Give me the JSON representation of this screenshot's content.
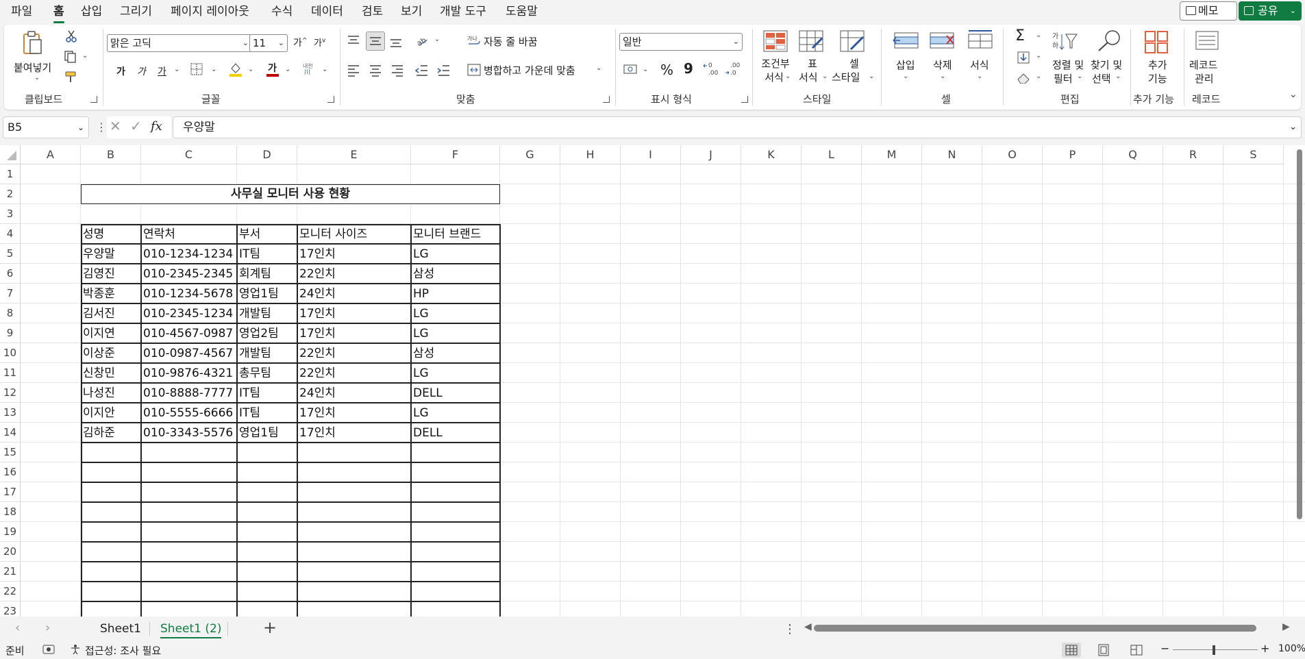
{
  "menu": {
    "tabs": [
      "파일",
      "홈",
      "삽입",
      "그리기",
      "페이지 레이아웃",
      "수식",
      "데이터",
      "검토",
      "보기",
      "개발 도구",
      "도움말"
    ],
    "active": "홈",
    "memo_label": "메모",
    "share_label": "공유"
  },
  "ribbon": {
    "clipboard": {
      "paste": "붙여넣기",
      "label": "클립보드"
    },
    "font": {
      "name": "맑은 고딕",
      "size": "11",
      "label": "글꼴",
      "bold": "가",
      "italic": "가",
      "underline": "가"
    },
    "alignment": {
      "wrap": "자동 줄 바꿈",
      "merge": "병합하고 가운데 맞춤",
      "label": "맞춤"
    },
    "number": {
      "format": "일반",
      "label": "표시 형식",
      "percent": "%",
      "comma": "9"
    },
    "styles": {
      "conditional": "조건부\n서식",
      "cond_l1": "조건부",
      "cond_l2": "서식",
      "table_l1": "표",
      "table_l2": "서식",
      "cell_l1": "셀",
      "cell_l2": "스타일",
      "label": "스타일"
    },
    "cells": {
      "insert": "삽입",
      "delete": "삭제",
      "format": "서식",
      "label": "셀"
    },
    "editing": {
      "sort_l1": "정렬 및",
      "sort_l2": "필터",
      "find_l1": "찾기 및",
      "find_l2": "선택",
      "label": "편집"
    },
    "addins": {
      "l1": "추가",
      "l2": "기능",
      "label": "추가 기능"
    },
    "records": {
      "l1": "레코드",
      "l2": "관리",
      "label": "레코드"
    }
  },
  "formula_bar": {
    "name_box": "B5",
    "formula": "우양말"
  },
  "columns": [
    "A",
    "B",
    "C",
    "D",
    "E",
    "F",
    "G",
    "H",
    "I",
    "J",
    "K",
    "L",
    "M",
    "N",
    "O",
    "P",
    "Q",
    "R",
    "S"
  ],
  "rows": [
    "1",
    "2",
    "3",
    "4",
    "5",
    "6",
    "7",
    "8",
    "9",
    "10",
    "11",
    "12",
    "13",
    "14",
    "15",
    "16",
    "17",
    "18",
    "19",
    "20",
    "21",
    "22",
    "23"
  ],
  "sheet": {
    "title": "사무실 모니터 사용 현황",
    "headers": [
      "성명",
      "연락처",
      "부서",
      "모니터 사이즈",
      "모니터 브랜드"
    ],
    "rows": [
      [
        "우양말",
        "010-1234-1234",
        "IT팀",
        "17인치",
        "LG"
      ],
      [
        "김영진",
        "010-2345-2345",
        "회계팀",
        "22인치",
        "삼성"
      ],
      [
        "박종훈",
        "010-1234-5678",
        "영업1팀",
        "24인치",
        "HP"
      ],
      [
        "김서진",
        "010-2345-1234",
        "개발팀",
        "17인치",
        "LG"
      ],
      [
        "이지연",
        "010-4567-0987",
        "영업2팀",
        "17인치",
        "LG"
      ],
      [
        "이상준",
        "010-0987-4567",
        "개발팀",
        "22인치",
        "삼성"
      ],
      [
        "신창민",
        "010-9876-4321",
        "총무팀",
        "22인치",
        "LG"
      ],
      [
        "나성진",
        "010-8888-7777",
        "IT팀",
        "24인치",
        "DELL"
      ],
      [
        "이지안",
        "010-5555-6666",
        "IT팀",
        "17인치",
        "LG"
      ],
      [
        "김하준",
        "010-3343-5576",
        "영업1팀",
        "17인치",
        "DELL"
      ]
    ]
  },
  "sheet_tabs": [
    "Sheet1",
    "Sheet1 (2)"
  ],
  "active_sheet": "Sheet1 (2)",
  "status": {
    "ready": "준비",
    "accessibility": "접근성: 조사 필요",
    "zoom": "100%"
  }
}
